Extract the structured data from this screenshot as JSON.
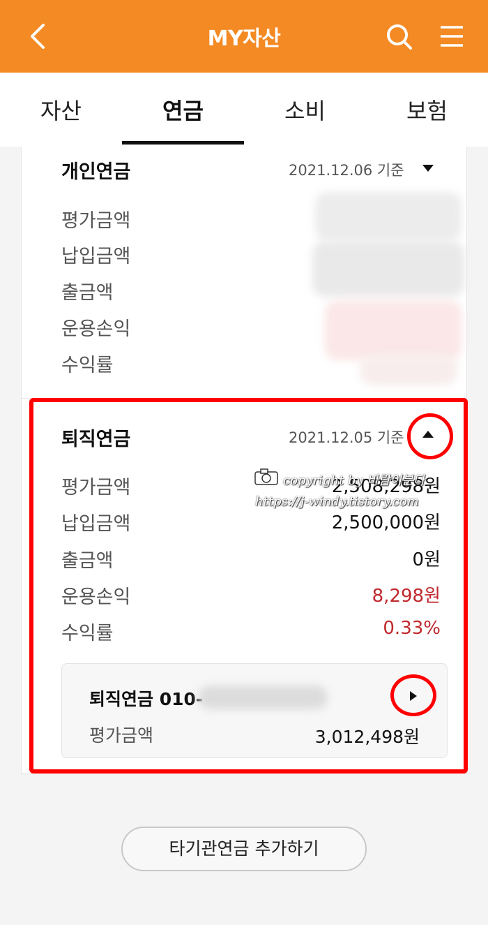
{
  "header": {
    "title": "MY자산",
    "bg_color": "#f38a24",
    "back_icon": "chevron-left-icon",
    "search_icon": "search-icon",
    "menu_icon": "hamburger-menu-icon"
  },
  "tabs": [
    {
      "label": "자산",
      "active": false
    },
    {
      "label": "연금",
      "active": true
    },
    {
      "label": "소비",
      "active": false
    },
    {
      "label": "보험",
      "active": false
    }
  ],
  "personal_pension": {
    "title": "개인연금",
    "date": "2021.12.06 기준",
    "toggle_icon": "caret-down-icon",
    "rows": [
      {
        "label": "평가금액"
      },
      {
        "label": "납입금액"
      },
      {
        "label": "출금액"
      },
      {
        "label": "운용손익"
      },
      {
        "label": "수익률"
      }
    ]
  },
  "retirement_pension": {
    "title": "퇴직연금",
    "date": "2021.12.05 기준",
    "toggle_icon": "caret-up-icon",
    "rows": [
      {
        "label": "평가금액",
        "value": "2,508,298원"
      },
      {
        "label": "납입금액",
        "value": "2,500,000원"
      },
      {
        "label": "출금액",
        "value": "0원"
      },
      {
        "label": "운용손익",
        "value": "8,298원"
      },
      {
        "label": "수익률",
        "value": "0.33%"
      }
    ],
    "account": {
      "name": "퇴직연금 010-",
      "label": "평가금액",
      "value": "3,012,498원",
      "arrow_icon": "caret-right-icon"
    }
  },
  "add_button": {
    "label": "타기관연금 추가하기"
  },
  "watermark": {
    "line1": "copyright by 바람이분다",
    "line2": "https://j-windy.tistory.com"
  },
  "colors": {
    "accent": "#f38a24",
    "profit": "#c0282d",
    "highlight": "#ff0000"
  }
}
